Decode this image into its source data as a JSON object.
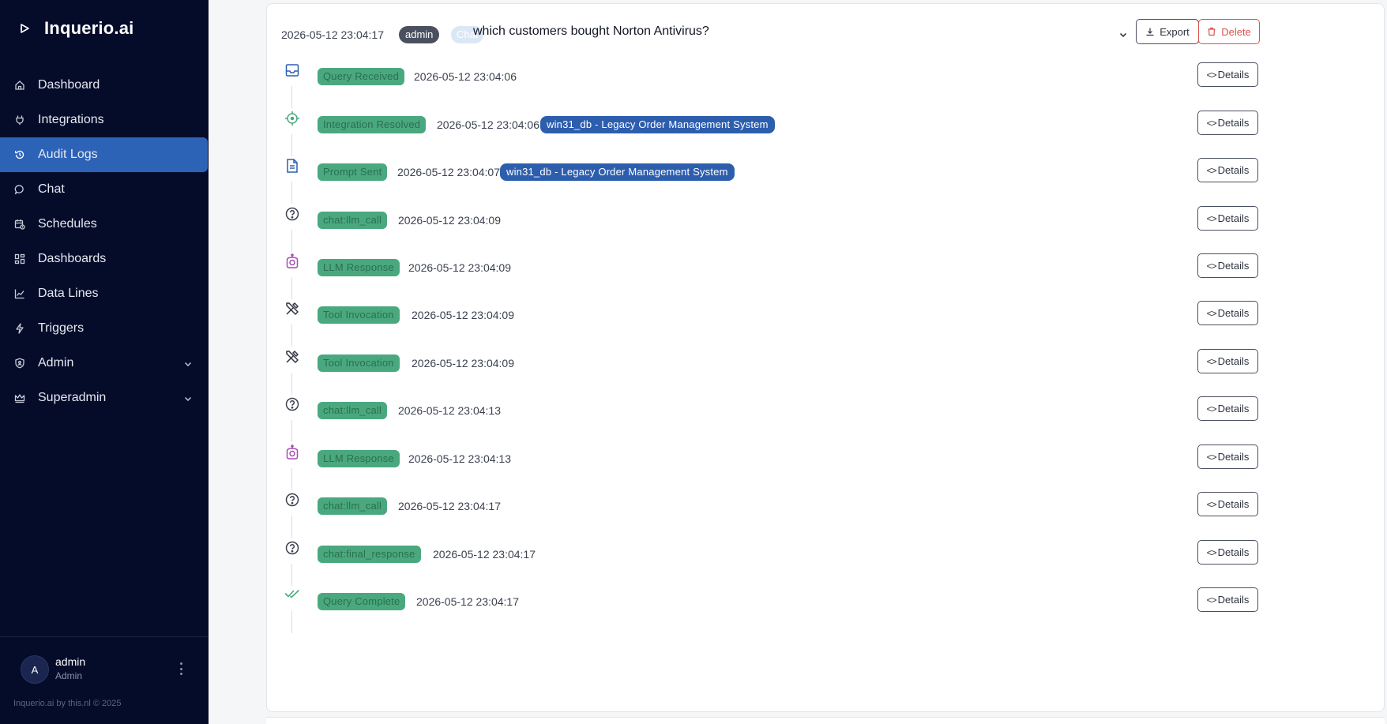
{
  "brand": {
    "name": "Inquerio.ai",
    "icon": "play-logo-icon"
  },
  "nav": {
    "items": [
      {
        "label": "Dashboard",
        "icon": "home-icon"
      },
      {
        "label": "Integrations",
        "icon": "plug-icon"
      },
      {
        "label": "Audit Logs",
        "icon": "history-icon",
        "active": true
      },
      {
        "label": "Chat",
        "icon": "chat-icon"
      },
      {
        "label": "Schedules",
        "icon": "calendar-clock-icon"
      },
      {
        "label": "Dashboards",
        "icon": "grid-icon"
      },
      {
        "label": "Data Lines",
        "icon": "line-chart-icon"
      },
      {
        "label": "Triggers",
        "icon": "bolt-icon"
      },
      {
        "label": "Admin",
        "icon": "shield-icon",
        "expandable": true
      },
      {
        "label": "Superadmin",
        "icon": "crown-icon",
        "expandable": true
      }
    ]
  },
  "user": {
    "initial": "A",
    "name": "admin",
    "role": "Admin"
  },
  "footer": {
    "copyright": "Inquerio.ai by this.nl © 2025"
  },
  "log": {
    "timestamp": "2026-05-12 23:04:17",
    "user_badge": "admin",
    "type_badge": "Chat",
    "query": "which customers bought Norton Antivirus?",
    "export_label": "Export",
    "delete_label": "Delete",
    "details_label": "Details",
    "colors": {
      "event_badge": "#4aa87f",
      "integration_badge": "#2d5eae",
      "delete": "#d9534f",
      "active_nav": "#2d63b6",
      "sidebar": "#050c2a"
    },
    "events": [
      {
        "label": "Query Received",
        "time": "2026-05-12 23:04:06",
        "icon": "inbox-icon"
      },
      {
        "label": "Integration Resolved",
        "time": "2026-05-12 23:04:06",
        "icon": "crosshair-icon",
        "integration": "win31_db - Legacy Order Management System"
      },
      {
        "label": "Prompt Sent",
        "time": "2026-05-12 23:04:07",
        "icon": "document-icon",
        "integration": "win31_db - Legacy Order Management System"
      },
      {
        "label": "chat:llm_call",
        "time": "2026-05-12 23:04:09",
        "icon": "question-icon"
      },
      {
        "label": "LLM Response",
        "time": "2026-05-12 23:04:09",
        "icon": "robot-icon"
      },
      {
        "label": "Tool Invocation",
        "time": "2026-05-12 23:04:09",
        "icon": "tools-icon"
      },
      {
        "label": "Tool Invocation",
        "time": "2026-05-12 23:04:09",
        "icon": "tools-icon"
      },
      {
        "label": "chat:llm_call",
        "time": "2026-05-12 23:04:13",
        "icon": "question-icon"
      },
      {
        "label": "LLM Response",
        "time": "2026-05-12 23:04:13",
        "icon": "robot-icon"
      },
      {
        "label": "chat:llm_call",
        "time": "2026-05-12 23:04:17",
        "icon": "question-icon"
      },
      {
        "label": "chat:final_response",
        "time": "2026-05-12 23:04:17",
        "icon": "question-icon"
      },
      {
        "label": "Query Complete",
        "time": "2026-05-12 23:04:17",
        "icon": "double-check-icon"
      }
    ]
  }
}
